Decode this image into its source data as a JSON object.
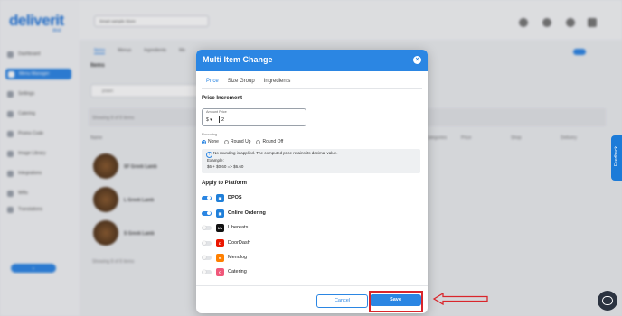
{
  "background": {
    "logo": "deliverit",
    "logo_sub": "deal",
    "location_select": "Smart sample Store",
    "sidebar": [
      "Dashboard",
      "Menu Manager",
      "Settings",
      "Catering",
      "Promo Code",
      "Image Library",
      "Integrations",
      "Wifis",
      "Translations"
    ],
    "sidebar_active_index": 1,
    "tabs": [
      "Items",
      "Menus",
      "Ingredients",
      "Mo"
    ],
    "active_tab": "Items",
    "menu_label": "Items",
    "search_placeholder": "prawn",
    "showing_text": "Showing 8 of 8 items",
    "showing_text_bottom": "Showing 8 of 8 items",
    "columns": [
      "Name",
      "Categories",
      "Price",
      "Shop",
      "Delivery"
    ],
    "rows": [
      {
        "name": "SF Greek Lamb"
      },
      {
        "name": "L Greek Lamb"
      },
      {
        "name": "S Greek Lamb"
      }
    ],
    "feedback_label": "Feedback"
  },
  "modal": {
    "title": "Multi Item Change",
    "close_glyph": "×",
    "tabs": [
      "Price",
      "Size Group",
      "Ingredients"
    ],
    "active_tab": "Price",
    "price_increment_title": "Price Increment",
    "amount_label": "Amount Price",
    "currency": "$ ▾",
    "amount_value": "2",
    "rounding_label": "Rounding",
    "rounding_options": [
      "None",
      "Round Up",
      "Round Off"
    ],
    "rounding_selected": "None",
    "info_text": "No rounding is applied. The computed price retains its decimal value.",
    "info_example_label": "Example:",
    "info_example_calc": "$6 + $0.60 => $6.60",
    "apply_title": "Apply to Platform",
    "platforms": [
      {
        "name": "DPOS",
        "enabled": true,
        "logo_color": "#1f7fd9",
        "icon": "dpos-icon"
      },
      {
        "name": "Online Ordering",
        "enabled": true,
        "logo_color": "#1f7fd9",
        "icon": "online-ordering-icon"
      },
      {
        "name": "Ubereats",
        "enabled": false,
        "logo_color": "#111111",
        "icon": "ubereats-icon"
      },
      {
        "name": "DoorDash",
        "enabled": false,
        "logo_color": "#eb1700",
        "icon": "doordash-icon"
      },
      {
        "name": "Menulog",
        "enabled": false,
        "logo_color": "#ff8000",
        "icon": "menulog-icon"
      },
      {
        "name": "Catering",
        "enabled": false,
        "logo_color": "#f0587a",
        "icon": "catering-icon"
      }
    ],
    "cancel_label": "Cancel",
    "save_label": "Save"
  },
  "colors": {
    "primary": "#2b86e3",
    "highlight": "#d9262c"
  }
}
